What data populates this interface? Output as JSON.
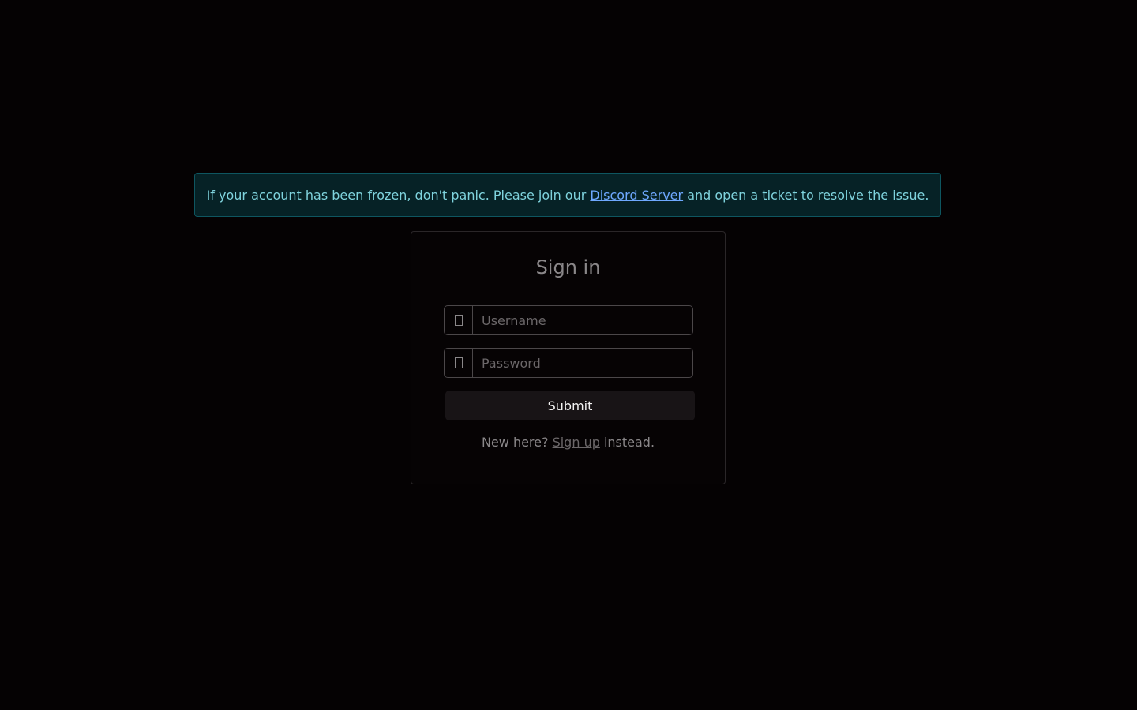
{
  "alert": {
    "text_before": "If your account has been frozen, don't panic. Please join our ",
    "link_text": "Discord Server",
    "text_after": " and open a ticket to resolve the issue."
  },
  "login": {
    "title": "Sign in",
    "username": {
      "icon": "user-icon",
      "placeholder": "Username",
      "value": ""
    },
    "password": {
      "icon": "lock-icon",
      "placeholder": "Password",
      "value": ""
    },
    "submit_label": "Submit",
    "footer": {
      "text_before": "New here? ",
      "link_text": "Sign up",
      "text_after": " instead."
    }
  },
  "colors": {
    "background": "#050203",
    "alert_bg": "#062226",
    "alert_text": "#7fd3dd",
    "link": "#6ea8fe"
  }
}
